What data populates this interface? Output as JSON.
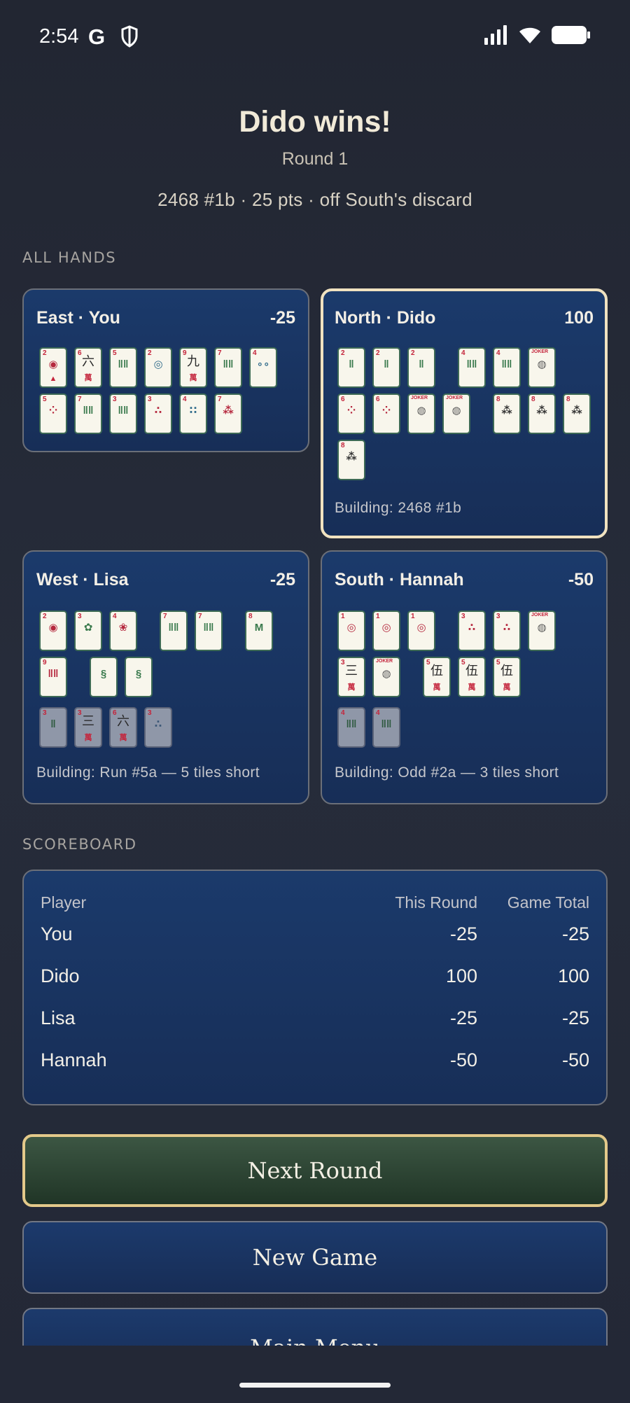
{
  "status": {
    "time": "2:54",
    "g": "G"
  },
  "header": {
    "title": "Dido wins!",
    "round": "Round 1",
    "win_info": "2468 #1b · 25 pts · off South's discard"
  },
  "labels": {
    "all_hands": "ALL HANDS",
    "scoreboard": "SCOREBOARD"
  },
  "hands": {
    "east": {
      "name": "East · You",
      "score": "-25"
    },
    "north": {
      "name": "North · Dido",
      "score": "100",
      "building": "Building: 2468 #1b"
    },
    "west": {
      "name": "West · Lisa",
      "score": "-25",
      "building": "Building: Run #5a — 5 tiles short"
    },
    "south": {
      "name": "South · Hannah",
      "score": "-50",
      "building": "Building: Odd #2a — 3 tiles short"
    }
  },
  "tiles": {
    "east_row1": [
      "2",
      "6",
      "5",
      "2",
      "9",
      "7",
      "4"
    ],
    "east_row2": [
      "5",
      "7",
      "3",
      "3",
      "4",
      "7"
    ],
    "north_row1": [
      "2",
      "2",
      "2",
      "4",
      "4",
      "JOKER"
    ],
    "north_row2": [
      "6",
      "6",
      "JOKER",
      "JOKER",
      "8",
      "8",
      "8"
    ],
    "north_row3": [
      "8"
    ],
    "west_row1": [
      "2",
      "3",
      "4",
      "7",
      "7",
      "8"
    ],
    "west_row2": [
      "9",
      "",
      ""
    ],
    "west_exposed": [
      "3",
      "3",
      "6",
      "3"
    ],
    "south_row1": [
      "1",
      "1",
      "1",
      "3",
      "3",
      "JOKER"
    ],
    "south_row2": [
      "3",
      "JOKER",
      "5",
      "5",
      "5"
    ],
    "south_exposed": [
      "4",
      "4"
    ]
  },
  "scoreboard": {
    "headers": {
      "player": "Player",
      "round": "This Round",
      "total": "Game Total"
    },
    "rows": [
      {
        "player": "You",
        "round": "-25",
        "total": "-25"
      },
      {
        "player": "Dido",
        "round": "100",
        "total": "100"
      },
      {
        "player": "Lisa",
        "round": "-25",
        "total": "-25"
      },
      {
        "player": "Hannah",
        "round": "-50",
        "total": "-50"
      }
    ]
  },
  "buttons": {
    "next": "Next Round",
    "new_game": "New Game",
    "main_menu": "Main Menu"
  }
}
